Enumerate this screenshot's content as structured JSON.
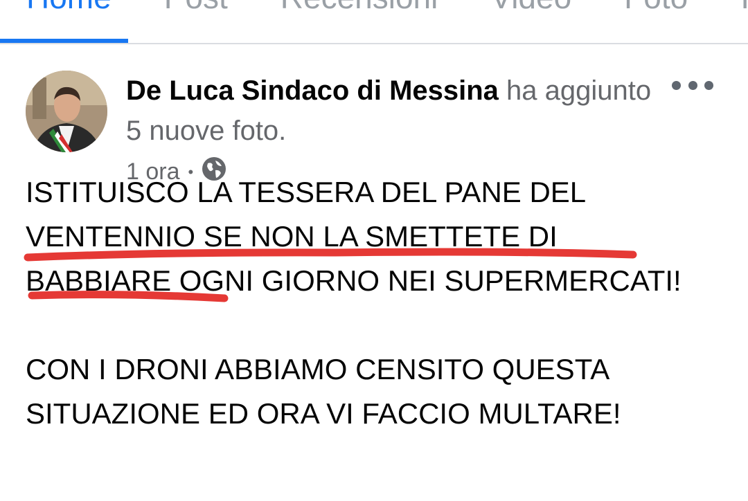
{
  "tabs": [
    "Home",
    "Post",
    "Recensioni",
    "Video",
    "Foto",
    "Informazioni"
  ],
  "post": {
    "author": "De Luca Sindaco di Messina",
    "action": " ha aggiunto 5 nuove foto.",
    "time": "1 ora",
    "separator": "•",
    "privacy_icon": "globe-icon",
    "more_icon": "more-options-icon",
    "text_lines_1": [
      "ISTITUISCO LA TESSERA DEL PANE DEL",
      "VENTENNIO SE NON LA SMETTETE DI",
      "BABBIARE OGNI GIORNO NEI SUPERMERCATI!"
    ],
    "text_lines_2": [
      "CON I DRONI ABBIAMO CENSITO QUESTA",
      "SITUAZIONE ED ORA VI FACCIO MULTARE!"
    ]
  },
  "colors": {
    "accent": "#1877f2",
    "underline": "#e53935",
    "secondary_text": "#65676b"
  }
}
